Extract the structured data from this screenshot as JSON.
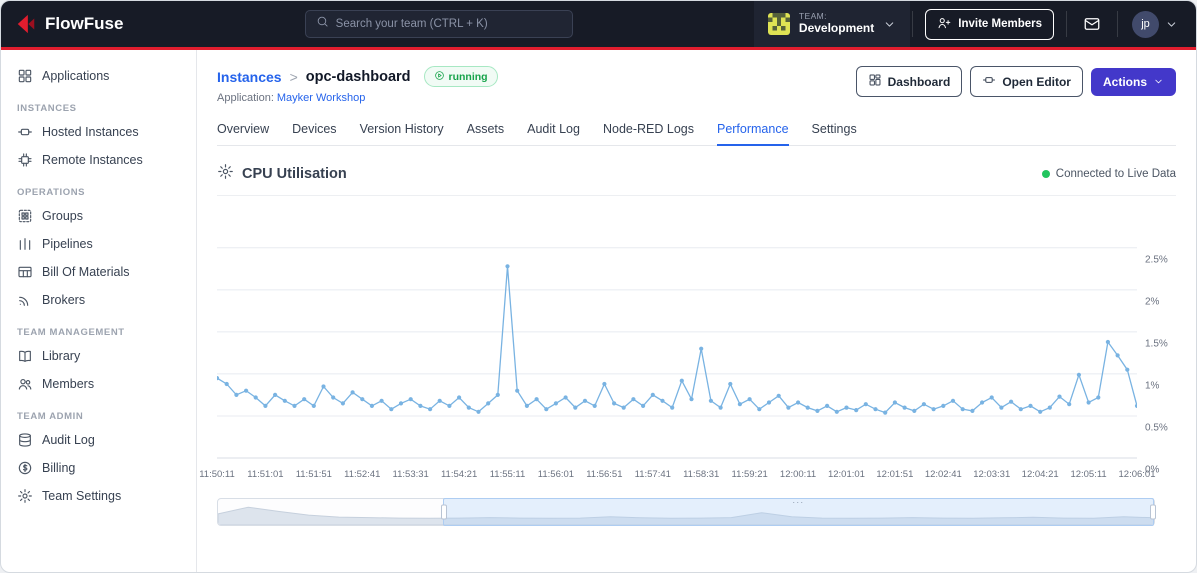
{
  "colors": {
    "accent-red": "#e11d2e",
    "link-blue": "#2563eb",
    "tab-blue": "#2563eb",
    "actions-purple": "#4338ca",
    "badge-green": "#16a34a",
    "live-green": "#22c55e",
    "chart-line": "#79b3e2"
  },
  "topbar": {
    "brand": "FlowFuse",
    "search_placeholder": "Search your team (CTRL + K)",
    "team_label": "TEAM:",
    "team_name": "Development",
    "invite_label": "Invite Members",
    "avatar_initials": "jp"
  },
  "sidebar": {
    "sections": [
      {
        "title": "",
        "items": [
          {
            "label": "Applications",
            "icon": "applications-icon"
          }
        ]
      },
      {
        "title": "INSTANCES",
        "items": [
          {
            "label": "Hosted Instances",
            "icon": "hosted-instances-icon"
          },
          {
            "label": "Remote Instances",
            "icon": "remote-instances-icon"
          }
        ]
      },
      {
        "title": "OPERATIONS",
        "items": [
          {
            "label": "Groups",
            "icon": "groups-icon"
          },
          {
            "label": "Pipelines",
            "icon": "pipelines-icon"
          },
          {
            "label": "Bill Of Materials",
            "icon": "bill-of-materials-icon"
          },
          {
            "label": "Brokers",
            "icon": "brokers-icon"
          }
        ]
      },
      {
        "title": "TEAM MANAGEMENT",
        "items": [
          {
            "label": "Library",
            "icon": "library-icon"
          },
          {
            "label": "Members",
            "icon": "members-icon"
          }
        ]
      },
      {
        "title": "TEAM ADMIN",
        "items": [
          {
            "label": "Audit Log",
            "icon": "audit-log-icon"
          },
          {
            "label": "Billing",
            "icon": "billing-icon"
          },
          {
            "label": "Team Settings",
            "icon": "team-settings-icon"
          }
        ]
      }
    ]
  },
  "page": {
    "breadcrumb_root": "Instances",
    "breadcrumb_sep": ">",
    "instance_name": "opc-dashboard",
    "status": "running",
    "application_label": "Application:",
    "application_name": "Mayker Workshop",
    "dashboard_button": "Dashboard",
    "open_editor_button": "Open Editor",
    "actions_button": "Actions"
  },
  "tabs": {
    "items": [
      "Overview",
      "Devices",
      "Version History",
      "Assets",
      "Audit Log",
      "Node-RED Logs",
      "Performance",
      "Settings"
    ],
    "active": "Performance"
  },
  "performance": {
    "title": "CPU Utilisation",
    "live_status": "Connected to Live Data"
  },
  "chart_data": {
    "type": "line",
    "title": "CPU Utilisation",
    "unit": "%",
    "y_axis_position": "right",
    "grid": true,
    "ylim": [
      0,
      2.95
    ],
    "y_tick_labels": [
      "0%",
      "0.5%",
      "1%",
      "1.5%",
      "2%",
      "2.5%"
    ],
    "x_tick_labels": [
      "11:50:11",
      "11:51:01",
      "11:51:51",
      "11:52:41",
      "11:53:31",
      "11:54:21",
      "11:55:11",
      "11:56:01",
      "11:56:51",
      "11:57:41",
      "11:58:31",
      "11:59:21",
      "12:00:11",
      "12:01:01",
      "12:01:51",
      "12:02:41",
      "12:03:31",
      "12:04:21",
      "12:05:11",
      "12:06:01"
    ],
    "series": [
      {
        "name": "CPU Utilisation",
        "values": [
          0.95,
          0.88,
          0.75,
          0.8,
          0.72,
          0.62,
          0.75,
          0.68,
          0.62,
          0.7,
          0.62,
          0.85,
          0.72,
          0.65,
          0.78,
          0.7,
          0.62,
          0.68,
          0.58,
          0.65,
          0.7,
          0.62,
          0.58,
          0.68,
          0.62,
          0.72,
          0.6,
          0.55,
          0.65,
          0.75,
          2.28,
          0.8,
          0.62,
          0.7,
          0.58,
          0.65,
          0.72,
          0.6,
          0.68,
          0.62,
          0.88,
          0.65,
          0.6,
          0.7,
          0.62,
          0.75,
          0.68,
          0.6,
          0.92,
          0.7,
          1.3,
          0.68,
          0.6,
          0.88,
          0.64,
          0.7,
          0.58,
          0.66,
          0.74,
          0.6,
          0.66,
          0.6,
          0.56,
          0.62,
          0.55,
          0.6,
          0.57,
          0.64,
          0.58,
          0.54,
          0.66,
          0.6,
          0.56,
          0.64,
          0.58,
          0.62,
          0.68,
          0.58,
          0.56,
          0.66,
          0.72,
          0.6,
          0.67,
          0.58,
          0.62,
          0.55,
          0.6,
          0.73,
          0.64,
          0.99,
          0.66,
          0.72,
          1.38,
          1.22,
          1.05,
          0.62
        ]
      }
    ],
    "navigator": {
      "values": [
        0.45,
        0.72,
        0.55,
        0.4,
        0.32,
        0.3,
        0.28,
        0.27,
        0.28,
        0.3,
        0.28,
        0.27,
        0.28,
        0.33,
        0.29,
        0.27,
        0.28,
        0.3,
        0.5,
        0.33,
        0.28,
        0.27,
        0.28,
        0.3,
        0.28,
        0.27,
        0.29,
        0.31,
        0.28,
        0.27,
        0.33,
        0.29
      ],
      "selection_start_pct": 24,
      "selection_end_pct": 100
    }
  }
}
